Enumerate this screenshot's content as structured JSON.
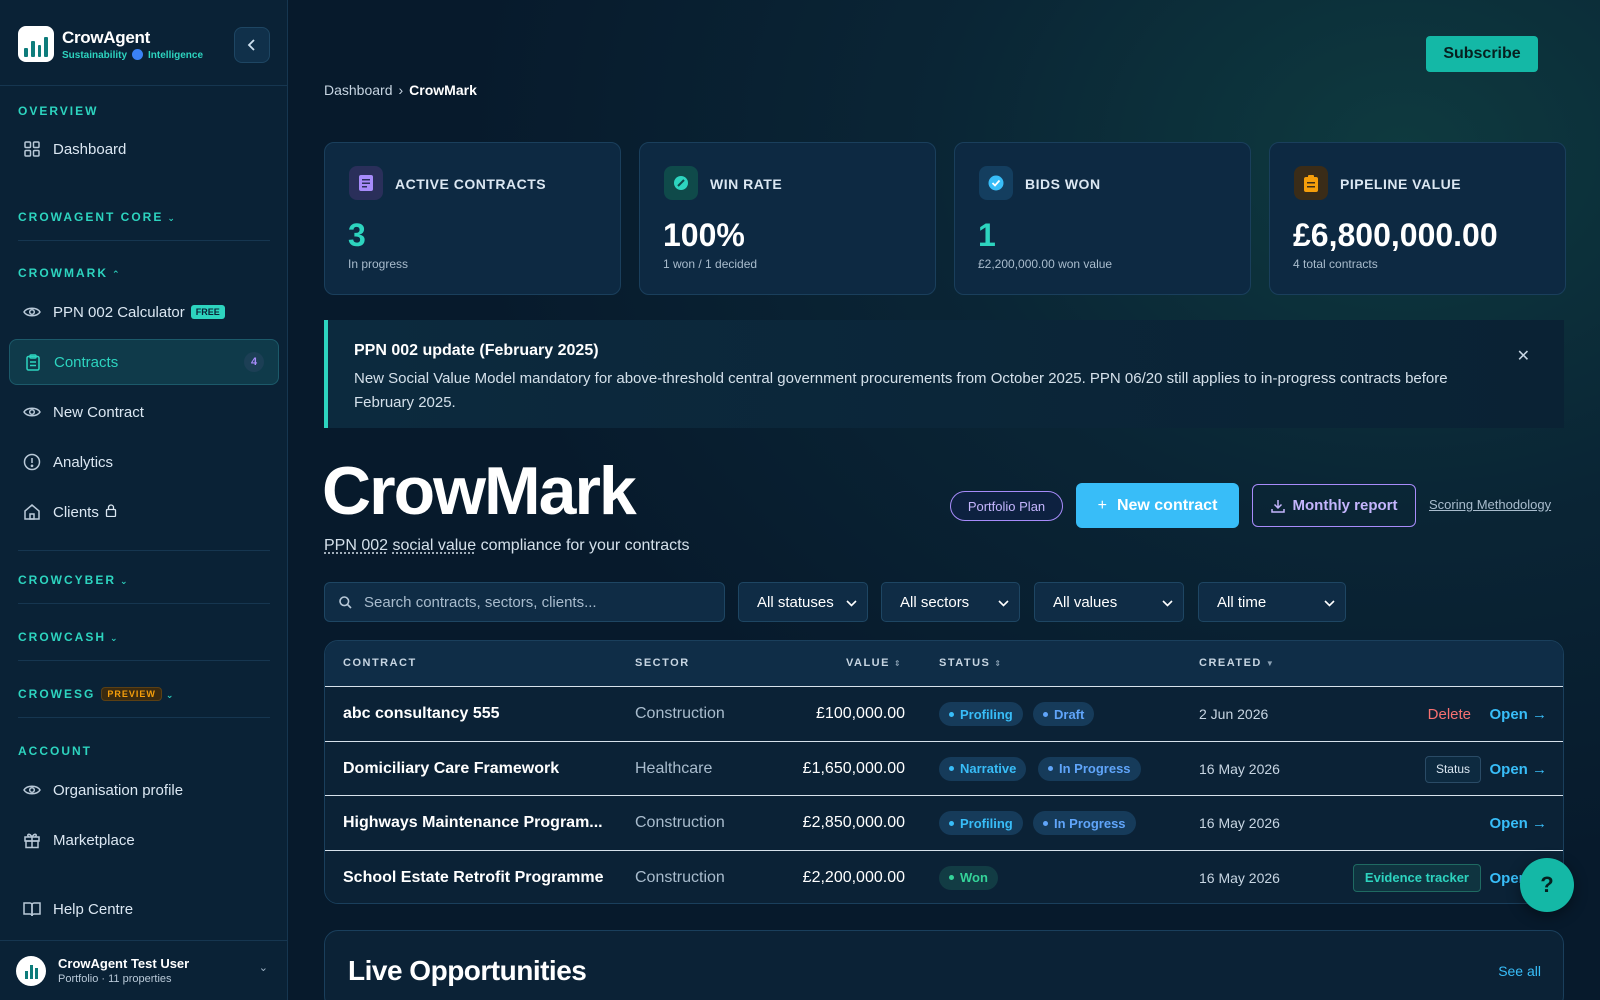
{
  "brand": {
    "name": "CrowAgent",
    "tag_left": "Sustainability",
    "tag_right": "Intelligence"
  },
  "sidebar": {
    "overview_label": "OVERVIEW",
    "dashboard": "Dashboard",
    "core_label": "CROWAGENT CORE",
    "crowmark_label": "CROWMARK",
    "items": [
      {
        "label": "PPN 002 Calculator",
        "badge": "FREE"
      },
      {
        "label": "Contracts",
        "count": "4"
      },
      {
        "label": "New Contract"
      },
      {
        "label": "Analytics"
      },
      {
        "label": "Clients"
      }
    ],
    "crowcyber_label": "CROWCYBER",
    "crowcash_label": "CROWCASH",
    "crowesg_label": "CROWESG",
    "preview_badge": "PREVIEW",
    "account_label": "ACCOUNT",
    "org_profile": "Organisation profile",
    "marketplace": "Marketplace",
    "help": "Help Centre",
    "user": {
      "name": "CrowAgent Test User",
      "sub": "Portfolio · 11 properties"
    }
  },
  "header": {
    "subscribe": "Subscribe",
    "breadcrumb_root": "Dashboard",
    "breadcrumb_current": "CrowMark"
  },
  "stats": [
    {
      "label": "ACTIVE CONTRACTS",
      "value": "3",
      "sub": "In progress",
      "color": "#2dd4bf"
    },
    {
      "label": "WIN RATE",
      "value": "100%",
      "sub": "1 won / 1 decided",
      "color": "#ffffff"
    },
    {
      "label": "BIDS WON",
      "value": "1",
      "sub": "£2,200,000.00 won value",
      "color": "#2dd4bf"
    },
    {
      "label": "PIPELINE VALUE",
      "value": "£6,800,000.00",
      "sub": "4 total contracts",
      "color": "#ffffff"
    }
  ],
  "notice": {
    "title": "PPN 002 update (February 2025)",
    "body": "New Social Value Model mandatory for above-threshold central government procurements from October 2025. PPN 06/20 still applies to in-progress contracts before February 2025."
  },
  "hero": {
    "title": "CrowMark",
    "sub_1": "PPN 002",
    "sub_2": "social value",
    "sub_3": "compliance for your contracts",
    "portfolio_plan": "Portfolio Plan",
    "new_contract": "New contract",
    "monthly_report": "Monthly report",
    "scoring": "Scoring Methodology"
  },
  "filters": {
    "search_placeholder": "Search contracts, sectors, clients...",
    "status": "All statuses",
    "sectors": "All sectors",
    "values": "All values",
    "time": "All time"
  },
  "table": {
    "headers": {
      "contract": "CONTRACT",
      "sector": "SECTOR",
      "value": "VALUE",
      "status": "STATUS",
      "created": "CREATED"
    },
    "rows": [
      {
        "name": "abc consultancy 555",
        "sector": "Construction",
        "value": "£100,000.00",
        "stage": "Profiling",
        "state": "Draft",
        "created": "2 Jun 2026",
        "action": "Delete",
        "open": "Open →"
      },
      {
        "name": "Domiciliary Care Framework",
        "sector": "Healthcare",
        "value": "£1,650,000.00",
        "stage": "Narrative",
        "state": "In Progress",
        "created": "16 May 2026",
        "action": "Status",
        "open": "Open →"
      },
      {
        "name": "Highways Maintenance Program...",
        "sector": "Construction",
        "value": "£2,850,000.00",
        "stage": "Profiling",
        "state": "In Progress",
        "created": "16 May 2026",
        "open": "Open →"
      },
      {
        "name": "School Estate Retrofit Programme",
        "sector": "Construction",
        "value": "£2,200,000.00",
        "stage": "Won",
        "created": "16 May 2026",
        "action": "Evidence tracker",
        "open": "Open →"
      }
    ]
  },
  "live": {
    "title": "Live Opportunities",
    "see_all": "See all"
  },
  "help_fab": "?"
}
